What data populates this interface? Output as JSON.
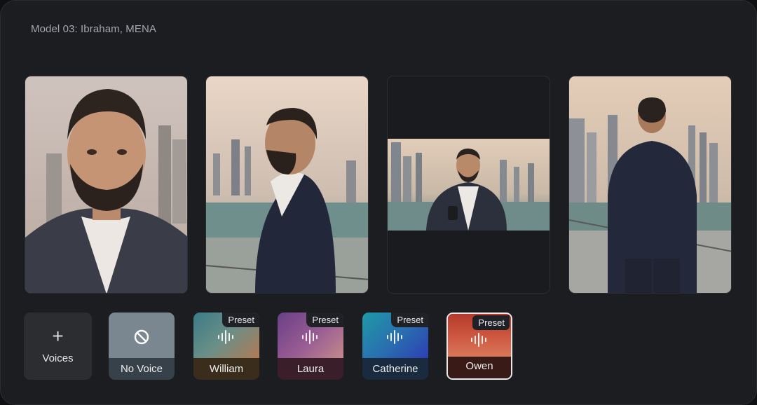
{
  "model_title": "Model 03: Ibraham, MENA",
  "photos": [
    {
      "description_icon": "portrait-photo"
    },
    {
      "description_icon": "profile-photo"
    },
    {
      "description_icon": "selfie-photo"
    },
    {
      "description_icon": "back-view-photo"
    }
  ],
  "voices": {
    "add_label": "Voices",
    "add_icon": "plus-icon",
    "items": [
      {
        "name": "No Voice",
        "badge": "",
        "icon": "no-voice-icon"
      },
      {
        "name": "William",
        "badge": "Preset",
        "icon": "waveform-icon"
      },
      {
        "name": "Laura",
        "badge": "Preset",
        "icon": "waveform-icon"
      },
      {
        "name": "Catherine",
        "badge": "Preset",
        "icon": "waveform-icon"
      },
      {
        "name": "Owen",
        "badge": "Preset",
        "icon": "waveform-icon",
        "selected": true
      }
    ]
  },
  "colors": {
    "panel": "#1c1d20",
    "selected_border": "#e8e9eb"
  }
}
